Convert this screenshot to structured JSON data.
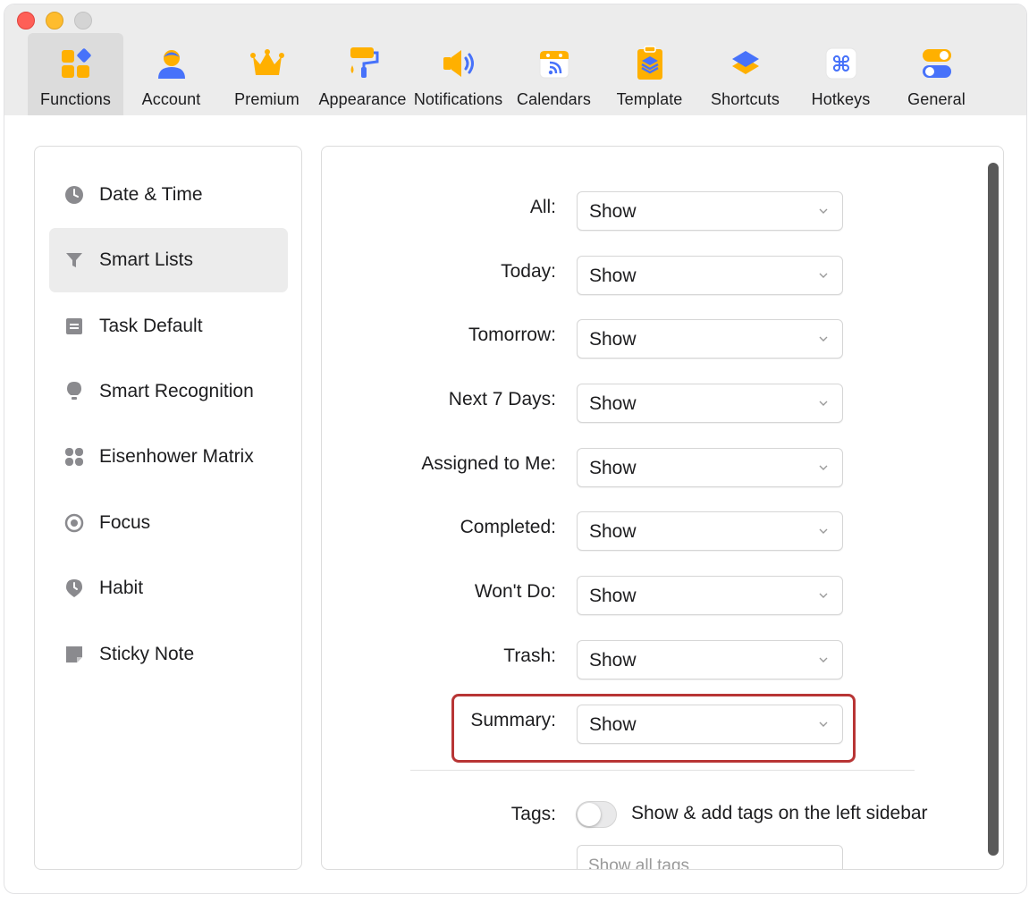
{
  "toolbar": {
    "items": [
      {
        "label": "Functions",
        "icon": "functions-icon",
        "active": true
      },
      {
        "label": "Account",
        "icon": "account-icon"
      },
      {
        "label": "Premium",
        "icon": "crown-icon"
      },
      {
        "label": "Appearance",
        "icon": "paint-roller-icon"
      },
      {
        "label": "Notifications",
        "icon": "speaker-icon"
      },
      {
        "label": "Calendars",
        "icon": "calendar-icon"
      },
      {
        "label": "Template",
        "icon": "template-icon"
      },
      {
        "label": "Shortcuts",
        "icon": "shortcuts-icon"
      },
      {
        "label": "Hotkeys",
        "icon": "command-icon"
      },
      {
        "label": "General",
        "icon": "toggle-icon"
      }
    ]
  },
  "sidebar": {
    "items": [
      {
        "label": "Date & Time",
        "icon": "clock-icon"
      },
      {
        "label": "Smart Lists",
        "icon": "filter-icon",
        "active": true
      },
      {
        "label": "Task Default",
        "icon": "task-default-icon"
      },
      {
        "label": "Smart Recognition",
        "icon": "lightbulb-icon"
      },
      {
        "label": "Eisenhower Matrix",
        "icon": "matrix-icon"
      },
      {
        "label": "Focus",
        "icon": "focus-icon"
      },
      {
        "label": "Habit",
        "icon": "habit-icon"
      },
      {
        "label": "Sticky Note",
        "icon": "sticky-note-icon"
      }
    ]
  },
  "settings": {
    "rows": [
      {
        "label": "All:",
        "value": "Show"
      },
      {
        "label": "Today:",
        "value": "Show"
      },
      {
        "label": "Tomorrow:",
        "value": "Show"
      },
      {
        "label": "Next 7 Days:",
        "value": "Show"
      },
      {
        "label": "Assigned to Me:",
        "value": "Show"
      },
      {
        "label": "Completed:",
        "value": "Show"
      },
      {
        "label": "Won't Do:",
        "value": "Show"
      },
      {
        "label": "Trash:",
        "value": "Show"
      },
      {
        "label": "Summary:",
        "value": "Show"
      }
    ],
    "tags": {
      "label": "Tags:",
      "toggle_text": "Show & add tags on the left sidebar",
      "toggle_on": false,
      "select_value": "Show all tags"
    }
  },
  "colors": {
    "accent_yellow": "#ffb000",
    "accent_blue": "#4772fa",
    "highlight_red": "#b83535"
  }
}
